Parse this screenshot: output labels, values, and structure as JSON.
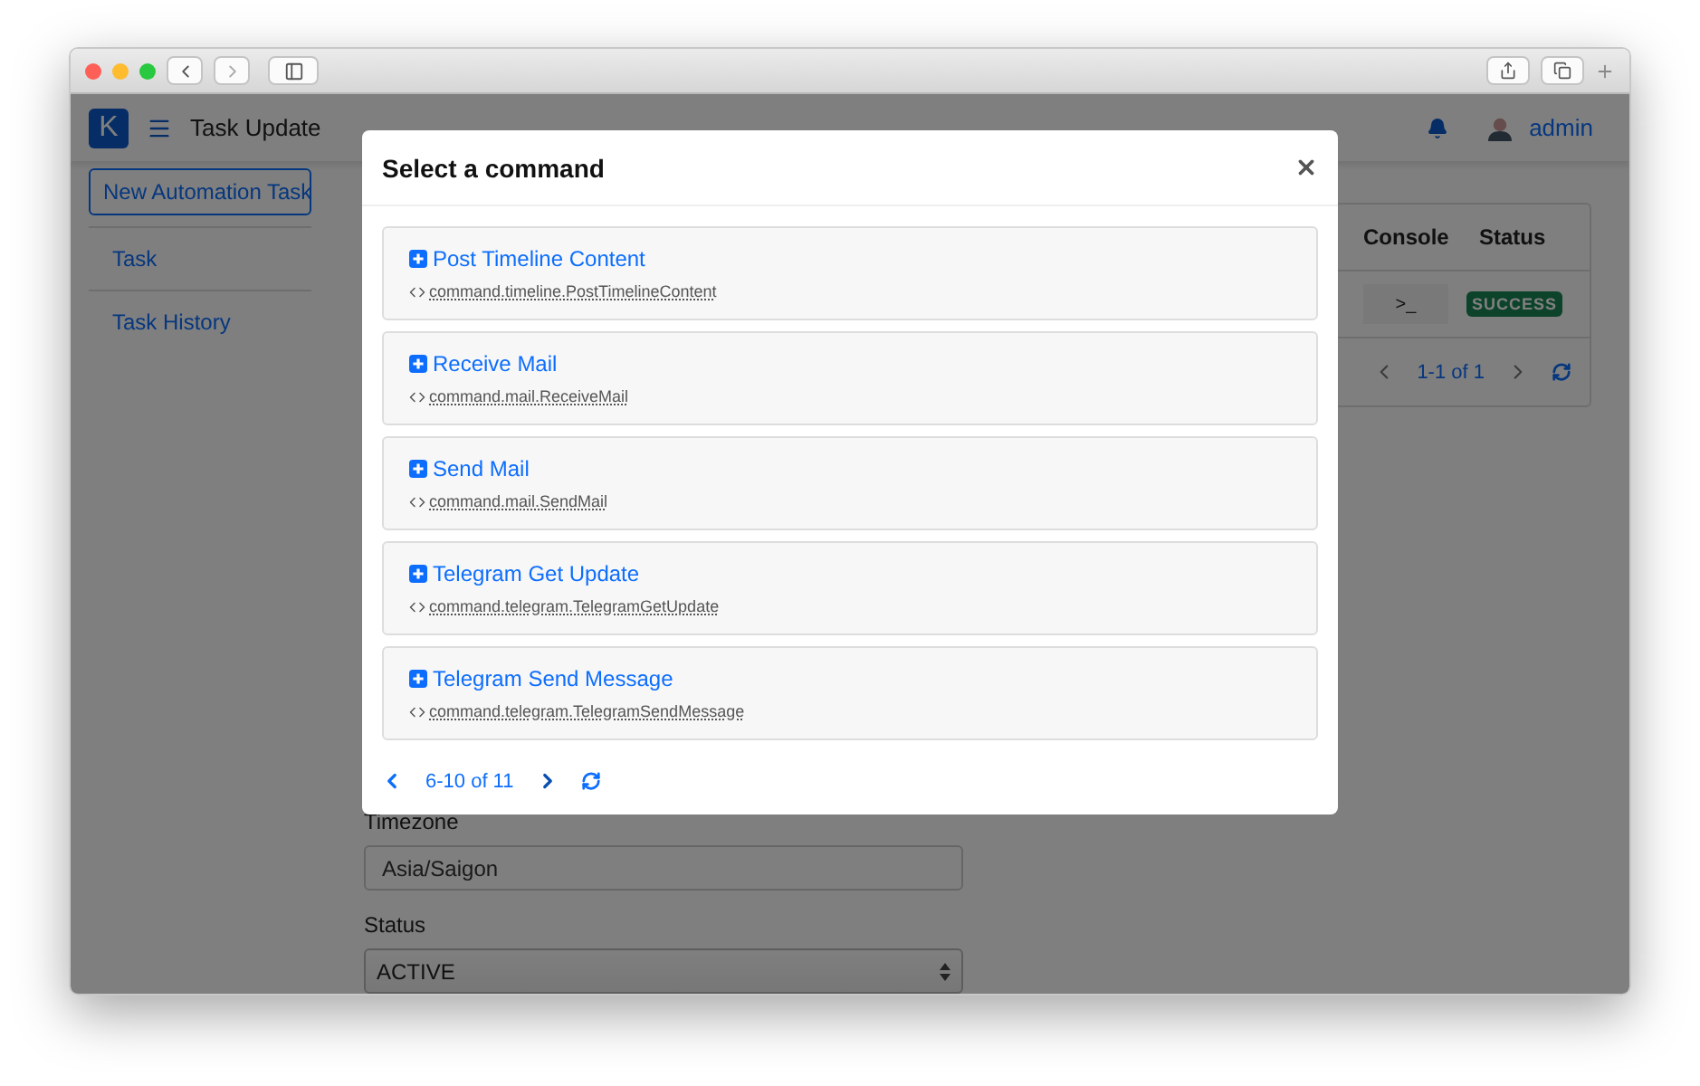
{
  "header": {
    "logo": "K",
    "title": "Task Update",
    "user": "admin"
  },
  "sidebar": {
    "button": "New Automation Task",
    "items": [
      {
        "label": "Task"
      },
      {
        "label": "Task History"
      }
    ]
  },
  "table": {
    "columns": [
      "Console",
      "Status"
    ],
    "rows": [
      {
        "console": ">_",
        "status": "SUCCESS"
      }
    ],
    "pagination": "1-1 of 1"
  },
  "form": {
    "fields": [
      {
        "label": "Timezone",
        "kind": "input",
        "value": "Asia/Saigon"
      },
      {
        "label": "Status",
        "kind": "select",
        "value": "ACTIVE"
      }
    ]
  },
  "modal": {
    "title": "Select a command",
    "commands": [
      {
        "name": "Post Timeline Content",
        "class": "command.timeline.PostTimelineContent"
      },
      {
        "name": "Receive Mail",
        "class": "command.mail.ReceiveMail"
      },
      {
        "name": "Send Mail",
        "class": "command.mail.SendMail"
      },
      {
        "name": "Telegram Get Update",
        "class": "command.telegram.TelegramGetUpdate"
      },
      {
        "name": "Telegram Send Message",
        "class": "command.telegram.TelegramSendMessage"
      }
    ],
    "pagination": "6-10 of 11"
  }
}
